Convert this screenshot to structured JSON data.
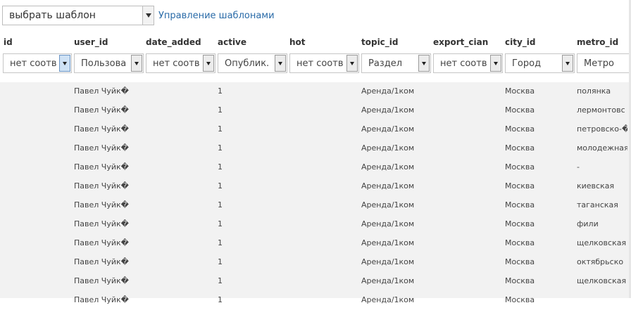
{
  "template_bar": {
    "select_value": "выбрать шаблон",
    "manage_link": "Управление шаблонами"
  },
  "columns": [
    {
      "key": "id",
      "header": "id",
      "filter": null
    },
    {
      "key": "user_id",
      "header": "user_id",
      "filter": "Пользова"
    },
    {
      "key": "date_added",
      "header": "date_added",
      "filter": "нет соотв"
    },
    {
      "key": "active",
      "header": "active",
      "filter": "Опублик."
    },
    {
      "key": "hot",
      "header": "hot",
      "filter": "нет соотв"
    },
    {
      "key": "topic_id",
      "header": "topic_id",
      "filter": "Раздел"
    },
    {
      "key": "export_cian",
      "header": "export_cian",
      "filter": "нет соотв"
    },
    {
      "key": "city_id",
      "header": "city_id",
      "filter": "Город"
    },
    {
      "key": "metro_id",
      "header": "metro_id",
      "filter": "Метро"
    }
  ],
  "id_filter": "нет соотв",
  "rows": [
    {
      "user": "Павел Чуйк�",
      "active": "1",
      "topic": "Аренда/1ком",
      "city": "Москва",
      "metro": "полянка"
    },
    {
      "user": "Павел Чуйк�",
      "active": "1",
      "topic": "Аренда/1ком",
      "city": "Москва",
      "metro": "лермонтовс"
    },
    {
      "user": "Павел Чуйк�",
      "active": "1",
      "topic": "Аренда/1ком",
      "city": "Москва",
      "metro": "петровско-�"
    },
    {
      "user": "Павел Чуйк�",
      "active": "1",
      "topic": "Аренда/1ком",
      "city": "Москва",
      "metro": "молодежная"
    },
    {
      "user": "Павел Чуйк�",
      "active": "1",
      "topic": "Аренда/1ком",
      "city": "Москва",
      "metro": "-"
    },
    {
      "user": "Павел Чуйк�",
      "active": "1",
      "topic": "Аренда/1ком",
      "city": "Москва",
      "metro": "киевская"
    },
    {
      "user": "Павел Чуйк�",
      "active": "1",
      "topic": "Аренда/1ком",
      "city": "Москва",
      "metro": "таганская"
    },
    {
      "user": "Павел Чуйк�",
      "active": "1",
      "topic": "Аренда/1ком",
      "city": "Москва",
      "metro": "фили"
    },
    {
      "user": "Павел Чуйк�",
      "active": "1",
      "topic": "Аренда/1ком",
      "city": "Москва",
      "metro": "щелковская"
    },
    {
      "user": "Павел Чуйк�",
      "active": "1",
      "topic": "Аренда/1ком",
      "city": "Москва",
      "metro": "октябрьско"
    },
    {
      "user": "Павел Чуйк�",
      "active": "1",
      "topic": "Аренда/1ком",
      "city": "Москва",
      "metro": "щелковская"
    },
    {
      "user": "Павел Чуйк�",
      "active": "1",
      "topic": "Аренда/1ком",
      "city": "Москва",
      "metro": ""
    }
  ],
  "colors": {
    "link": "#2a6ba8",
    "data_bg": "#f2f2f2",
    "active_button": "#cfe2f5"
  }
}
